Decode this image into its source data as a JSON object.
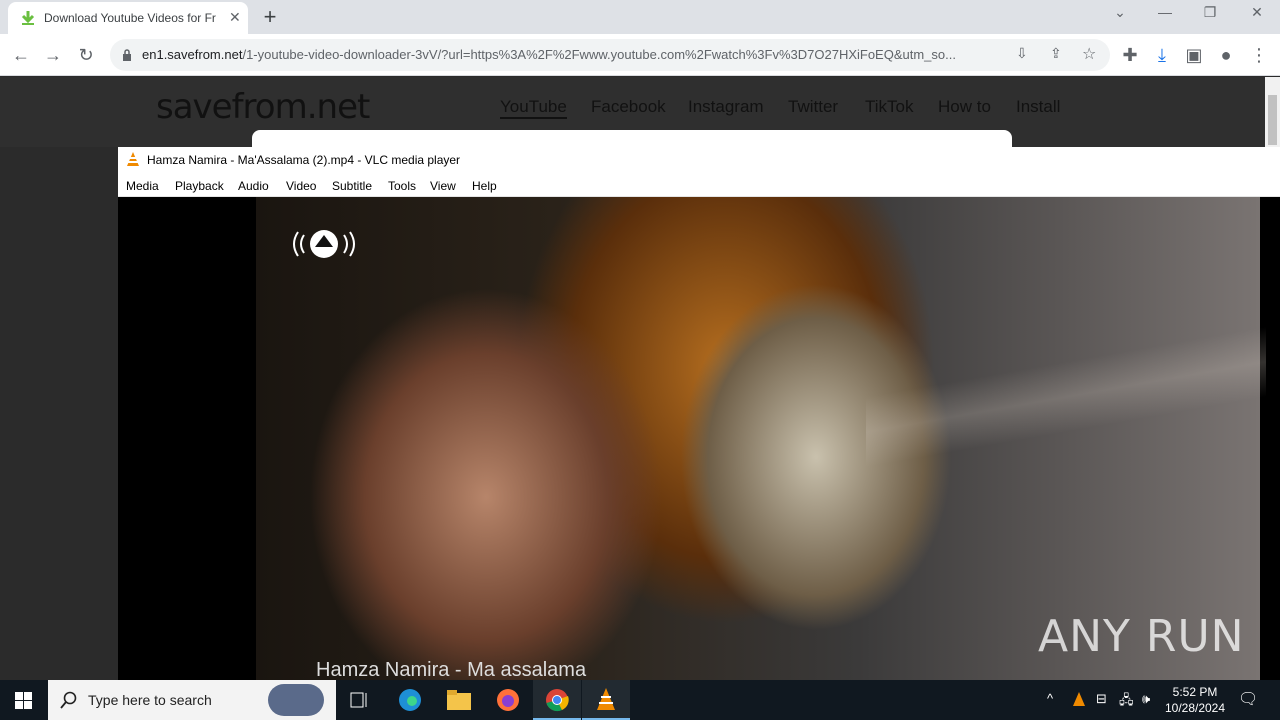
{
  "browser": {
    "tab_title": "Download Youtube Videos for Free",
    "tab_close": "✕",
    "new_tab": "+",
    "url_host": "en1.savefrom.net",
    "url_path": "/1-youtube-video-downloader-3vV/?url=https%3A%2F%2Fwww.youtube.com%2Fwatch%3Fv%3D7O27HXiFoEQ&utm_so..."
  },
  "site": {
    "logo": "savefrom.net",
    "nav": [
      "YouTube",
      "Facebook",
      "Instagram",
      "Twitter",
      "TikTok",
      "How to",
      "Install"
    ]
  },
  "vlc": {
    "title": "Hamza Namira - Ma'Assalama  (2).mp4 - VLC media player",
    "menu": [
      "Media",
      "Playback",
      "Audio",
      "Video",
      "Subtitle",
      "Tools",
      "View",
      "Help"
    ],
    "caption": "Hamza Namira - Ma assalama",
    "watermark": "ANY RUN"
  },
  "taskbar": {
    "search_placeholder": "Type here to search",
    "time": "5:52 PM",
    "date": "10/28/2024"
  },
  "colors": {
    "chrome_tab_bg": "#dee1e6",
    "taskbar_bg": "#101820",
    "vlc_orange": "#f08a00"
  }
}
